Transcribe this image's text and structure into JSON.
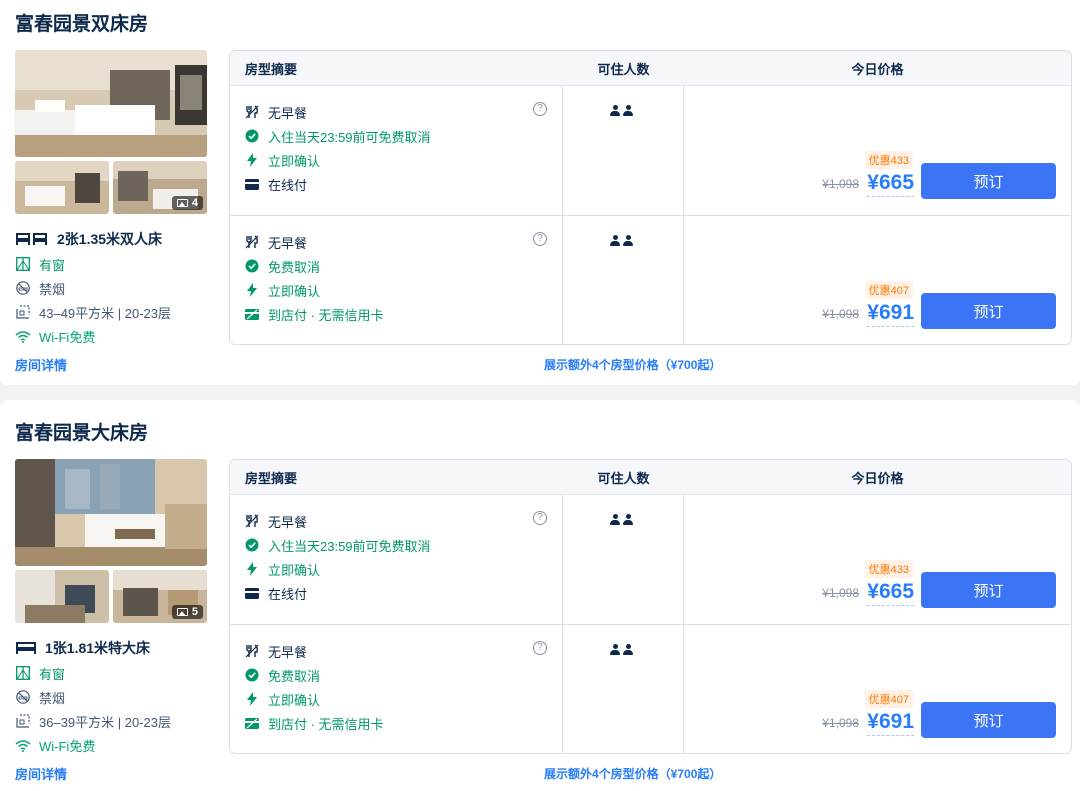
{
  "rooms": [
    {
      "title": "富春园景双床房",
      "photo_count": "4",
      "bed": "2张1.35米双人床",
      "window": "有窗",
      "smoking": "禁烟",
      "area": "43–49平方米 | 20-23层",
      "wifi": "Wi-Fi免费",
      "details_link": "房间详情",
      "table_header": {
        "summary": "房型摘要",
        "guests": "可住人数",
        "price": "今日价格"
      },
      "rates": [
        {
          "features": [
            "无早餐",
            "入住当天23:59前可免费取消",
            "立即确认",
            "在线付"
          ],
          "discount": "优惠433",
          "original_price": "¥1,098",
          "price": "¥665",
          "book_label": "预订"
        },
        {
          "features": [
            "无早餐",
            "免费取消",
            "立即确认",
            "到店付 · 无需信用卡"
          ],
          "discount": "优惠407",
          "original_price": "¥1,098",
          "price": "¥691",
          "book_label": "预订"
        }
      ],
      "more_link": "展示额外4个房型价格（¥700起）"
    },
    {
      "title": "富春园景大床房",
      "photo_count": "5",
      "bed": "1张1.81米特大床",
      "window": "有窗",
      "smoking": "禁烟",
      "area": "36–39平方米 | 20-23层",
      "wifi": "Wi-Fi免费",
      "details_link": "房间详情",
      "table_header": {
        "summary": "房型摘要",
        "guests": "可住人数",
        "price": "今日价格"
      },
      "rates": [
        {
          "features": [
            "无早餐",
            "入住当天23:59前可免费取消",
            "立即确认",
            "在线付"
          ],
          "discount": "优惠433",
          "original_price": "¥1,098",
          "price": "¥665",
          "book_label": "预订"
        },
        {
          "features": [
            "无早餐",
            "免费取消",
            "立即确认",
            "到店付 · 无需信用卡"
          ],
          "discount": "优惠407",
          "original_price": "¥1,098",
          "price": "¥691",
          "book_label": "预订"
        }
      ],
      "more_link": "展示额外4个房型价格（¥700起）"
    }
  ],
  "colors": {
    "accent": "#287dfa",
    "button": "#3b75f5",
    "green": "#00976c",
    "discount": "#ff7700"
  }
}
